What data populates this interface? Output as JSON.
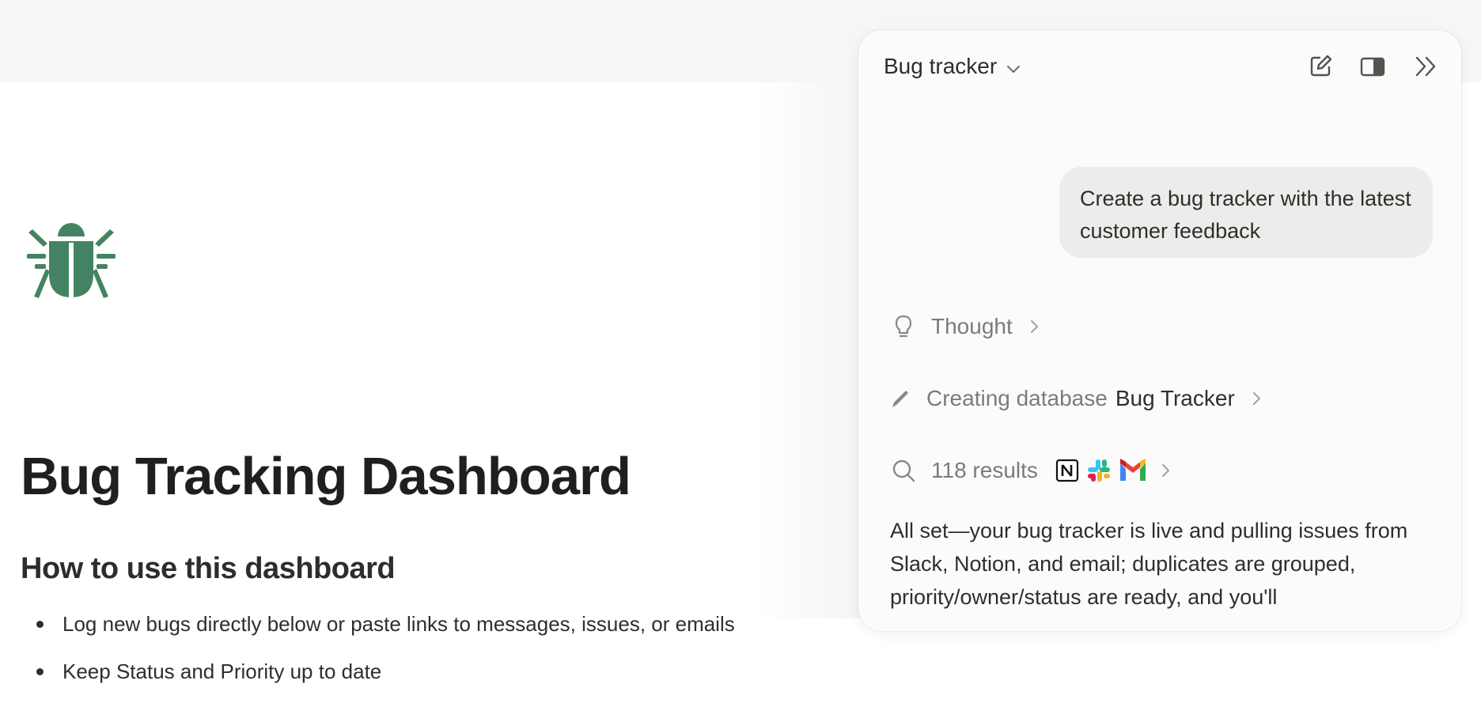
{
  "page": {
    "title": "Bug Tracking Dashboard",
    "section_heading": "How to use this dashboard",
    "bullets": [
      "Log new bugs directly below or paste links to messages, issues, or emails",
      "Keep Status and Priority up to date"
    ],
    "icon": "bug-icon",
    "icon_color": "#448361"
  },
  "ai_panel": {
    "title": "Bug tracker",
    "header_buttons": [
      "new-chat-icon",
      "panel-toggle-icon",
      "collapse-icon"
    ],
    "user_message": "Create a bug tracker with the latest customer feedback",
    "steps": {
      "thought": {
        "label": "Thought",
        "icon": "lightbulb-icon"
      },
      "creating": {
        "label": "Creating database",
        "target": "Bug Tracker",
        "icon": "pencil-icon"
      },
      "search": {
        "label": "118 results",
        "icon": "search-icon",
        "sources": [
          "notion-logo",
          "slack-logo",
          "gmail-logo"
        ]
      }
    },
    "response": "All set—your bug tracker is live and pulling issues from Slack, Notion, and email; duplicates are grouped, priority/owner/status are ready, and you'll"
  }
}
